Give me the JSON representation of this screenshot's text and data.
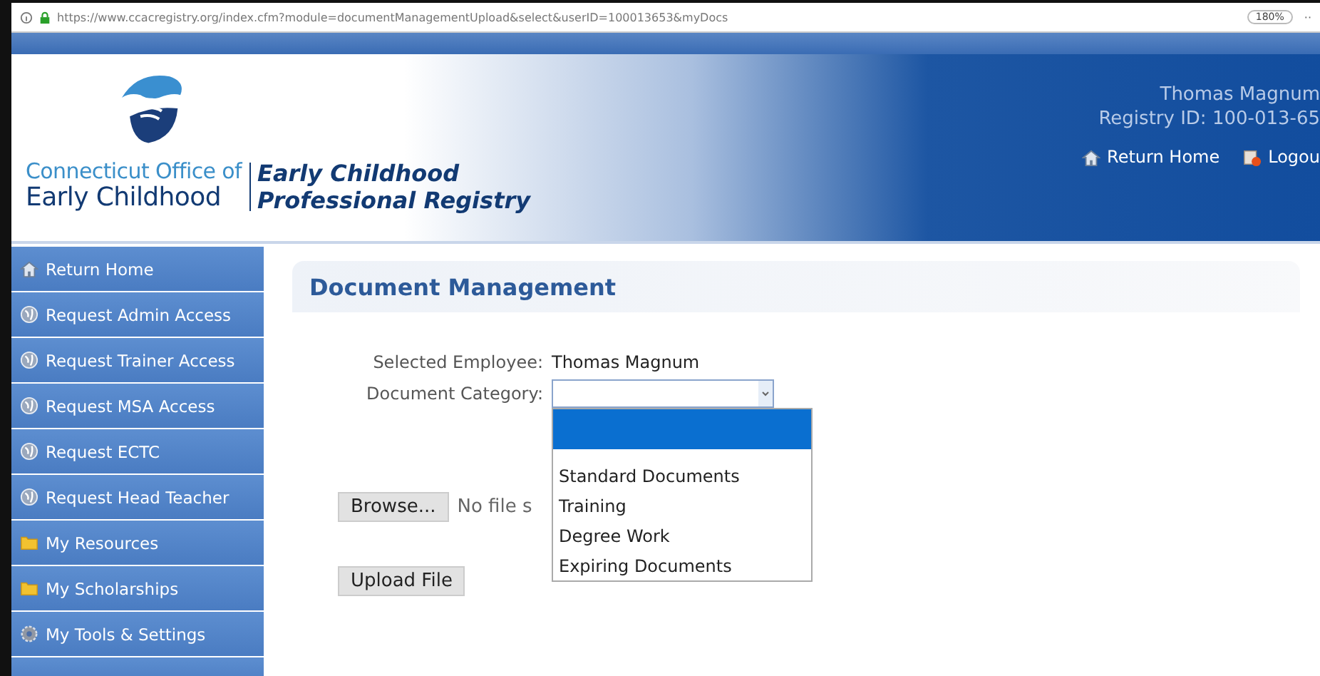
{
  "browser": {
    "url": "https://www.ccacregistry.org/index.cfm?module=documentManagementUpload&select&userID=100013653&myDocs",
    "zoom": "180%",
    "more": "··"
  },
  "header": {
    "logo_line_1": "Connecticut Office of",
    "logo_line_2": "Early Childhood",
    "title_line_1": "Early Childhood",
    "title_line_2": "Professional Registry",
    "user_name": "Thomas Magnum",
    "registry_id": "Registry ID: 100-013-65",
    "links": [
      {
        "label": "Return Home",
        "kind": "home"
      },
      {
        "label": "Logou",
        "kind": "logout"
      }
    ]
  },
  "sidebar": {
    "items": [
      {
        "label": "Return Home",
        "kind": "home"
      },
      {
        "label": "Request Admin Access",
        "kind": "globe"
      },
      {
        "label": "Request Trainer Access",
        "kind": "globe"
      },
      {
        "label": "Request MSA Access",
        "kind": "globe"
      },
      {
        "label": "Request ECTC",
        "kind": "globe"
      },
      {
        "label": "Request Head Teacher",
        "kind": "globe"
      },
      {
        "label": "My Resources",
        "kind": "folder"
      },
      {
        "label": "My Scholarships",
        "kind": "folder"
      },
      {
        "label": "My Tools & Settings",
        "kind": "tools"
      }
    ]
  },
  "panel": {
    "title": "Document Management",
    "employee_label": "Selected Employee:",
    "employee_value": "Thomas Magnum",
    "category_label": "Document Category:",
    "category_options": [
      {
        "selected": true
      },
      {
        "label": "Standard Documents",
        "selected": false
      },
      {
        "label": "Training",
        "selected": false
      },
      {
        "label": "Degree Work",
        "selected": false
      },
      {
        "label": "Expiring Documents",
        "selected": false
      }
    ],
    "browse_button": "Browse...",
    "file_status": "No file s",
    "upload_button": "Upload File"
  }
}
